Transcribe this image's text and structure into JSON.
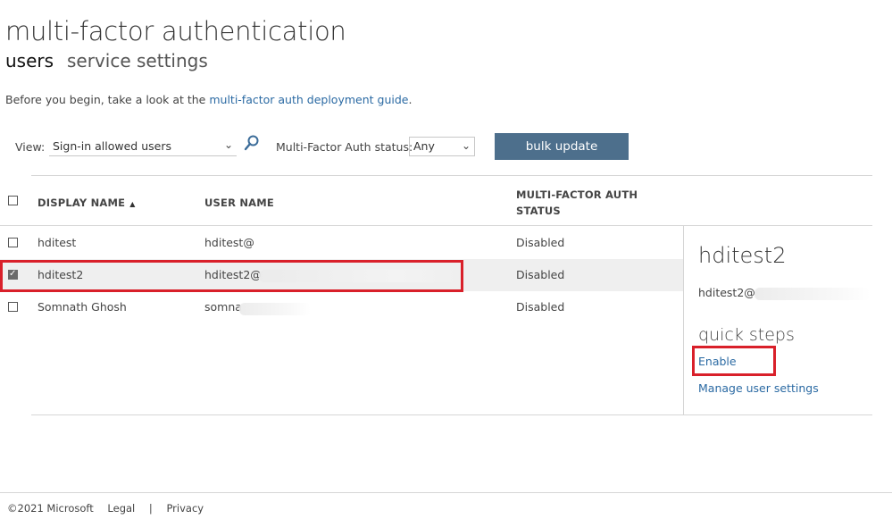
{
  "page": {
    "title": "multi-factor authentication",
    "tabs": [
      "users",
      "service settings"
    ]
  },
  "intro": {
    "text": "Before you begin, take a look at the ",
    "link": "multi-factor auth deployment guide",
    "suffix": "."
  },
  "filters": {
    "view_label": "View:",
    "view_value": "Sign-in allowed users",
    "mfa_label": "Multi-Factor Auth status:",
    "mfa_value": "Any",
    "bulk_update": "bulk update"
  },
  "table": {
    "headers": {
      "display_name": "DISPLAY NAME",
      "user_name": "USER NAME",
      "mfa_status_line1": "MULTI-FACTOR AUTH",
      "mfa_status_line2": "STATUS"
    },
    "rows": [
      {
        "display_name": "hditest",
        "user_name": "hditest@",
        "status": "Disabled",
        "checked": false
      },
      {
        "display_name": "hditest2",
        "user_name": "hditest2@",
        "status": "Disabled",
        "checked": true
      },
      {
        "display_name": "Somnath Ghosh",
        "user_name": "somna",
        "status": "Disabled",
        "checked": false
      }
    ]
  },
  "panel": {
    "title": "hditest2",
    "user": "hditest2@",
    "quick_steps": "quick steps",
    "enable": "Enable",
    "manage": "Manage user settings"
  },
  "footer": {
    "copyright": "©2021 Microsoft",
    "legal": "Legal",
    "sep": "|",
    "privacy": "Privacy"
  },
  "colors": {
    "accent_button": "#4d6f8c",
    "link": "#2b6aa3",
    "highlight_box": "#d9202a"
  }
}
